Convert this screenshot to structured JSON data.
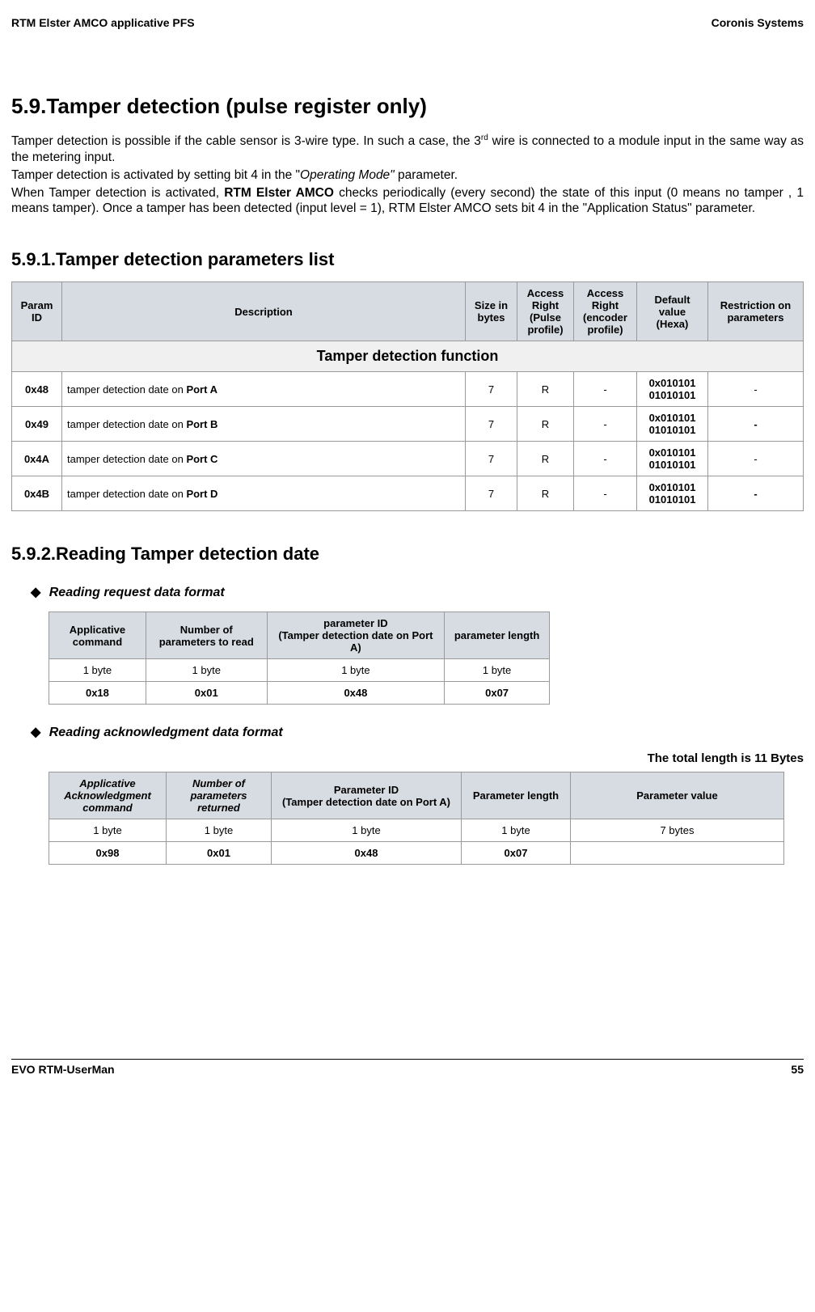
{
  "hdr": {
    "left": "RTM Elster AMCO applicative PFS",
    "right": "Coronis Systems"
  },
  "h1": "5.9.Tamper detection (pulse register only)",
  "p1a": "Tamper detection is possible if the cable sensor is 3-wire type. In such a case, the 3",
  "p1sup": "rd",
  "p1b": " wire is connected to a module input in the same way as the metering input.",
  "p2a": "Tamper detection is activated by setting bit 4 in the \"",
  "p2i": "Operating Mode\"",
  "p2b": " parameter.",
  "p3a": "When Tamper detection is activated, ",
  "p3bold": "RTM Elster AMCO",
  "p3b": " checks periodically (every second) the state of this input (0 means no tamper , 1 means tamper). Once a tamper has been detected (input level = 1), RTM Elster AMCO sets bit 4 in the \"Application Status\" parameter.",
  "h2a": "5.9.1.Tamper detection parameters list",
  "t1": {
    "h": [
      "Param ID",
      "Description",
      "Size in bytes",
      "Access Right (Pulse profile)",
      "Access Right (encoder profile)",
      "Default value (Hexa)",
      "Restriction on parameters"
    ],
    "section": "Tamper detection function",
    "rows": [
      {
        "id": "0x48",
        "d1": "tamper detection date on ",
        "d2": "Port A",
        "s": "7",
        "a1": "R",
        "a2": "-",
        "dv": "0x010101 01010101",
        "r": "-"
      },
      {
        "id": "0x49",
        "d1": "tamper detection date on ",
        "d2": "Port B",
        "s": "7",
        "a1": "R",
        "a2": "-",
        "dv": "0x010101 01010101",
        "r": "-"
      },
      {
        "id": "0x4A",
        "d1": "tamper detection date on ",
        "d2": "Port C",
        "s": "7",
        "a1": "R",
        "a2": "-",
        "dv": "0x010101 01010101",
        "r": "-"
      },
      {
        "id": "0x4B",
        "d1": "tamper detection date on ",
        "d2": "Port D",
        "s": "7",
        "a1": "R",
        "a2": "-",
        "dv": "0x010101 01010101",
        "r": "-"
      }
    ]
  },
  "h2b": "5.9.2.Reading Tamper detection date",
  "h3a": "Reading request data format",
  "t2": {
    "h": [
      "Applicative command",
      "Number of parameters  to read",
      "parameter ID\n(Tamper detection date on Port A)",
      "parameter length"
    ],
    "r1": [
      "1 byte",
      "1 byte",
      "1 byte",
      "1 byte"
    ],
    "r2": [
      "0x18",
      "0x01",
      "0x48",
      "0x07"
    ]
  },
  "h3b": "Reading acknowledgment data format",
  "note": "The total length is 11 Bytes",
  "t3": {
    "h": [
      "Applicative Acknowledgment command",
      "Number of parameters returned",
      "Parameter ID\n(Tamper detection date on Port A)",
      "Parameter length",
      "Parameter value"
    ],
    "r1": [
      "1 byte",
      "1 byte",
      "1 byte",
      "1 byte",
      "7 bytes"
    ],
    "r2": [
      "0x98",
      "0x01",
      "0x48",
      "0x07",
      ""
    ]
  },
  "ftr": {
    "left": "EVO RTM-UserMan",
    "right": "55"
  }
}
